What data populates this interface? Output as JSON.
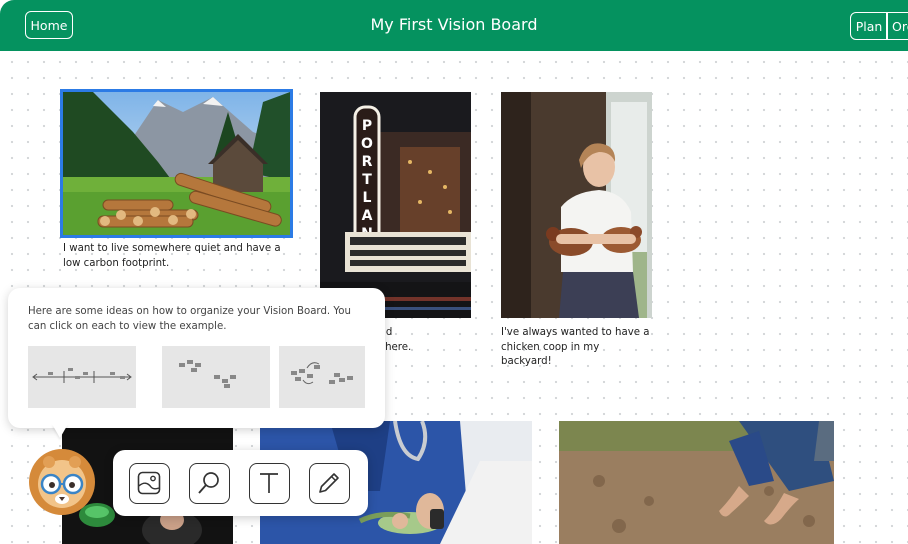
{
  "header": {
    "title": "My First Vision Board",
    "home_label": "Home",
    "plan_label": "Plan",
    "organize_label": "Org"
  },
  "board": {
    "cards": [
      {
        "caption": "I want to live somewhere quiet and have a low carbon footprint.",
        "image": "mountain-cabin-with-logs-photo"
      },
      {
        "caption": "…ear Portland\n…ter works there.",
        "image": "portland-theater-sign-photo"
      },
      {
        "caption": "I've always wanted to have a chicken coop in my backyard!",
        "image": "girl-holding-chickens-photo"
      },
      {
        "image": "scientist-lab-photo"
      },
      {
        "image": "vet-holding-lizard-photo"
      },
      {
        "image": "hands-planting-soil-photo"
      }
    ]
  },
  "tip": {
    "text": "Here are some ideas on how to organize your Vision Board. You can click on each to view the example.",
    "options": [
      "timeline-layout",
      "grouped-layout",
      "clustered-layout"
    ]
  },
  "toolbar": {
    "tools": [
      "image-tool",
      "search-tool",
      "text-tool",
      "pencil-tool"
    ]
  },
  "colors": {
    "brand_green": "#05925f",
    "selection_blue": "#2c7be5"
  }
}
